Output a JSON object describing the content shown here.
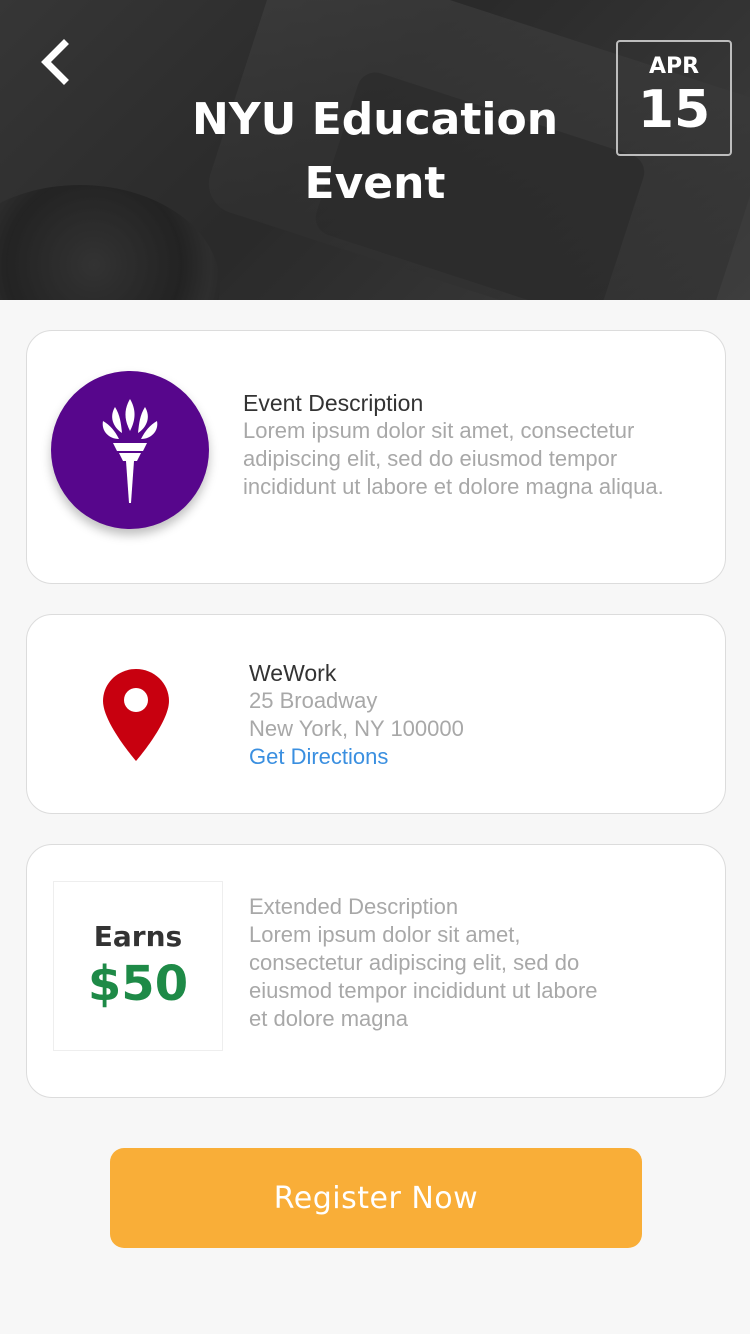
{
  "header": {
    "title": "NYU Education Event",
    "date_month": "APR",
    "date_day": "15"
  },
  "event_card": {
    "logo": "nyu-torch-icon",
    "heading": "Event Description",
    "body": "Lorem ipsum dolor sit amet, consectetur adipiscing elit, sed do eiusmod tempor incididunt ut labore et dolore magna aliqua."
  },
  "location_card": {
    "icon": "map-pin-icon",
    "venue": "WeWork",
    "address_line1": "25 Broadway",
    "address_line2": "New York, NY 100000",
    "directions_label": "Get Directions"
  },
  "earnings_card": {
    "earn_label": "Earns",
    "earn_amount": "$50",
    "heading": "Extended Description",
    "body": "Lorem ipsum dolor sit amet, consectetur adipiscing elit, sed do eiusmod tempor incididunt ut labore et dolore magna"
  },
  "actions": {
    "register_label": "Register Now"
  },
  "colors": {
    "nyu_purple": "#57068c",
    "pin_red": "#c8000f",
    "earn_green": "#1e8a47",
    "register_orange": "#f9ae38",
    "link_blue": "#3a8fe0"
  }
}
